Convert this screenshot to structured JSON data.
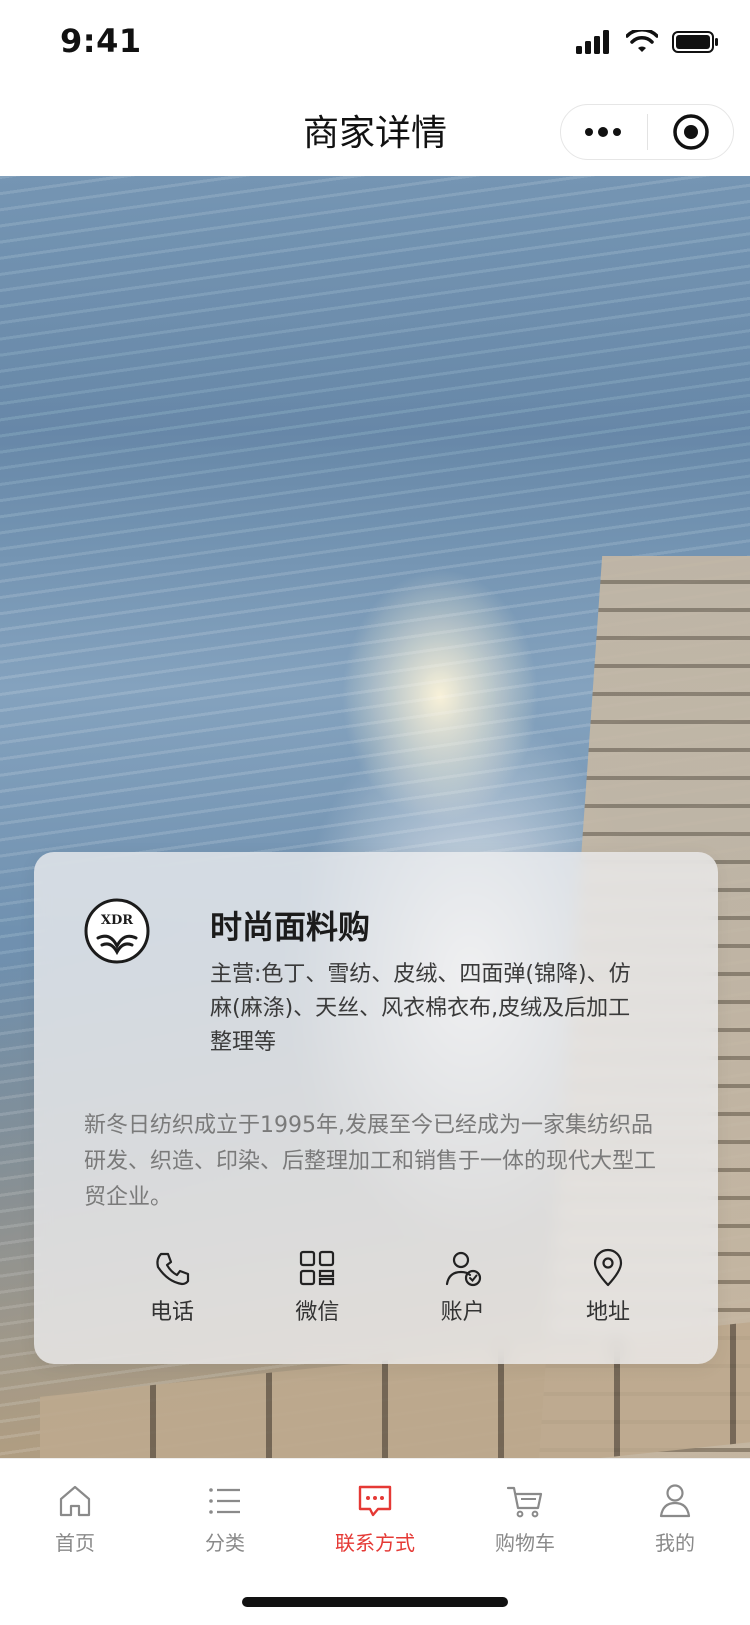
{
  "status_bar": {
    "time": "9:41"
  },
  "nav": {
    "title": "商家详情"
  },
  "merchant": {
    "logo_text": "XDR",
    "name": "时尚面料购",
    "main_business": "主营:色丁、雪纺、皮绒、四面弹(锦降)、仿麻(麻涤)、天丝、风衣棉衣布,皮绒及后加工整理等",
    "description": "新冬日纺织成立于1995年,发展至今已经成为一家集纺织品研发、织造、印染、后整理加工和销售于一体的现代大型工贸企业。"
  },
  "actions": [
    {
      "label": "电话",
      "icon": "phone-icon"
    },
    {
      "label": "微信",
      "icon": "qrcode-icon"
    },
    {
      "label": "账户",
      "icon": "account-icon"
    },
    {
      "label": "地址",
      "icon": "location-icon"
    }
  ],
  "tabbar": {
    "active_color": "#e53935",
    "items": [
      {
        "label": "首页",
        "icon": "home-icon",
        "active": false
      },
      {
        "label": "分类",
        "icon": "list-icon",
        "active": false
      },
      {
        "label": "联系方式",
        "icon": "chat-icon",
        "active": true
      },
      {
        "label": "购物车",
        "icon": "cart-icon",
        "active": false
      },
      {
        "label": "我的",
        "icon": "user-icon",
        "active": false
      }
    ]
  }
}
